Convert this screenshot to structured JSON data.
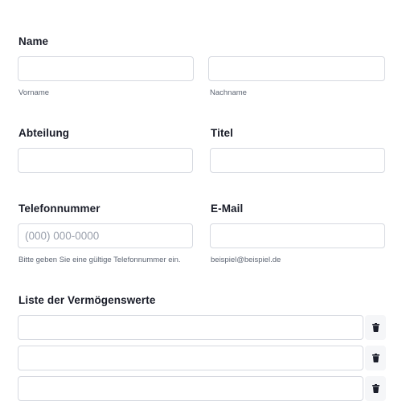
{
  "name_section": {
    "label": "Name",
    "first_name": {
      "value": "",
      "sublabel": "Vorname"
    },
    "last_name": {
      "value": "",
      "sublabel": "Nachname"
    }
  },
  "department": {
    "label": "Abteilung",
    "value": ""
  },
  "title": {
    "label": "Titel",
    "value": ""
  },
  "phone": {
    "label": "Telefonnummer",
    "value": "",
    "placeholder": "(000) 000-0000",
    "sublabel": "Bitte geben Sie eine gültige Telefonnummer ein."
  },
  "email": {
    "label": "E-Mail",
    "value": "",
    "sublabel": "beispiel@beispiel.de"
  },
  "assets": {
    "label": "Liste der Vermögenswerte",
    "rows": [
      {
        "value": "",
        "delete_icon": "trash-icon"
      },
      {
        "value": "",
        "delete_icon": "trash-icon"
      },
      {
        "value": "",
        "delete_icon": "trash-icon"
      }
    ]
  }
}
